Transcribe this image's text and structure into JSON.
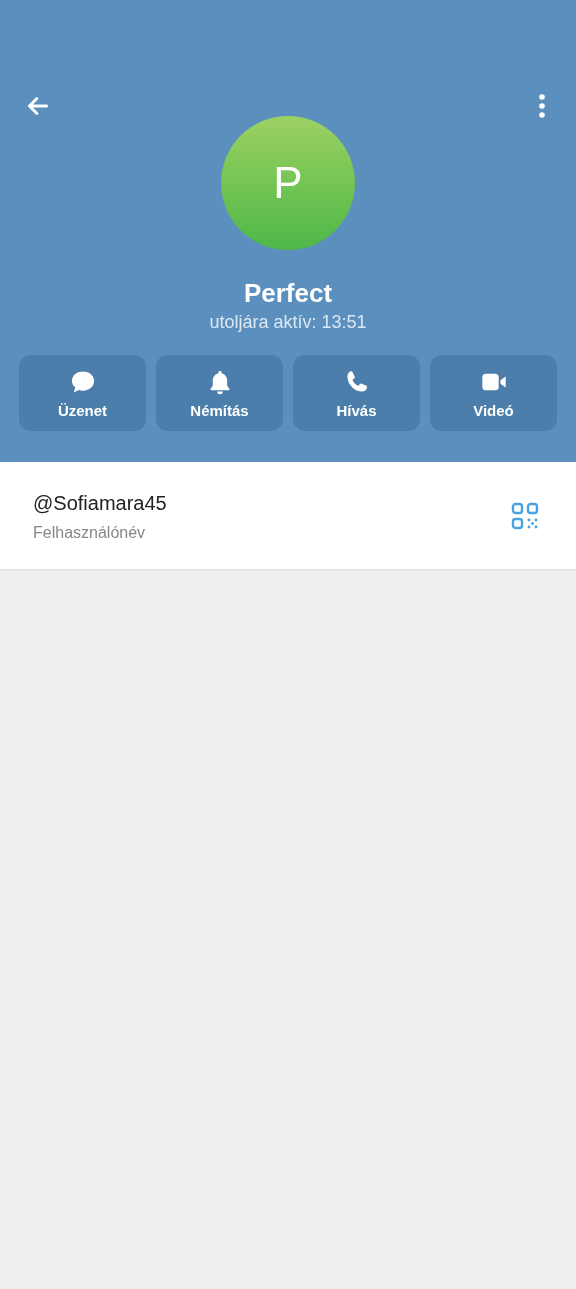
{
  "profile": {
    "initial": "P",
    "name": "Perfect",
    "status": "utoljára aktív: 13:51"
  },
  "actions": [
    {
      "kind": "message",
      "label": "Üzenet"
    },
    {
      "kind": "mute",
      "label": "Némítás"
    },
    {
      "kind": "call",
      "label": "Hívás"
    },
    {
      "kind": "video",
      "label": "Videó"
    }
  ],
  "info": {
    "value": "@Sofiamara45",
    "caption": "Felhasználónév"
  }
}
